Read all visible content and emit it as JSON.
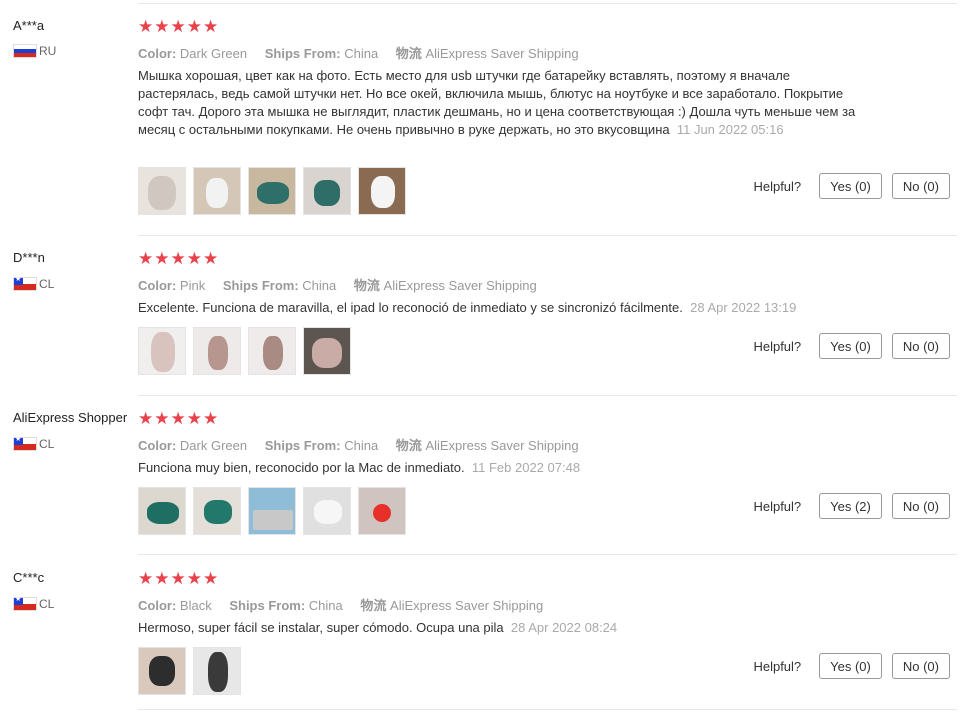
{
  "helpful_label": "Helpful?",
  "attr_labels": {
    "color": "Color:",
    "ships": "Ships From:",
    "logistics": "物流"
  },
  "reviews": [
    {
      "author": "A***a",
      "country": "RU",
      "rating": 5,
      "color": "Dark Green",
      "ships_from": "China",
      "shipping": "AliExpress Saver Shipping",
      "text": "Мышка хорошая, цвет как на фото. Есть место для usb штучки где батарейку вставлять, поэтому я вначале растерялась, ведь самой штучки нет. Но все окей, включила мышь, блютус на ноутбуке и все заработало. Покрытие софт тач. Дорого эта мышка не выглядит, пластик дешмань, но и цена соответствующая :) Дошла чуть меньше чем за месяц с остальными покупками. Не очень привычно в руке держать, но это вкусовщина",
      "date": "11 Jun 2022 05:16",
      "yes": "Yes (0)",
      "no": "No (0)",
      "photo_count": 5
    },
    {
      "author": "D***n",
      "country": "CL",
      "rating": 5,
      "color": "Pink",
      "ships_from": "China",
      "shipping": "AliExpress Saver Shipping",
      "text": "Excelente. Funciona de maravilla, el ipad lo reconoció de inmediato y se sincronizó fácilmente.",
      "date": "28 Apr 2022 13:19",
      "yes": "Yes (0)",
      "no": "No (0)",
      "photo_count": 4
    },
    {
      "author": "AliExpress Shopper",
      "country": "CL",
      "rating": 5,
      "color": "Dark Green",
      "ships_from": "China",
      "shipping": "AliExpress Saver Shipping",
      "text": "Funciona muy bien, reconocido por la Mac de inmediato.",
      "date": "11 Feb 2022 07:48",
      "yes": "Yes (2)",
      "no": "No (0)",
      "photo_count": 5
    },
    {
      "author": "C***c",
      "country": "CL",
      "rating": 5,
      "color": "Black",
      "ships_from": "China",
      "shipping": "AliExpress Saver Shipping",
      "text": "Hermoso, super fácil se instalar, super cómodo. Ocupa una pila",
      "date": "28 Apr 2022 08:24",
      "yes": "Yes (0)",
      "no": "No (0)",
      "photo_count": 2
    }
  ]
}
